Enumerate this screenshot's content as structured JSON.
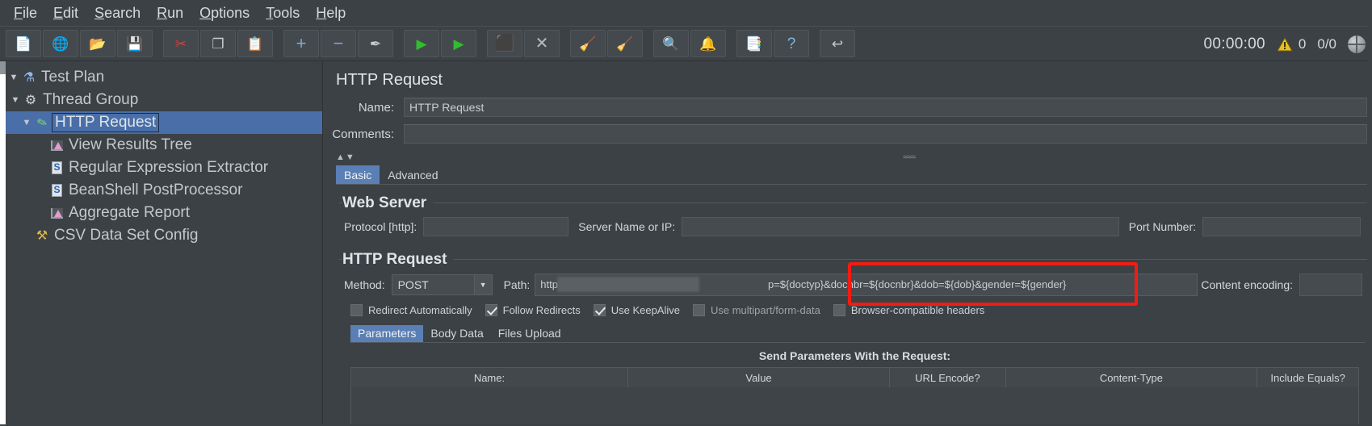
{
  "menubar": {
    "items": [
      {
        "label": "File",
        "mnemonic": "F"
      },
      {
        "label": "Edit",
        "mnemonic": "E"
      },
      {
        "label": "Search",
        "mnemonic": "S"
      },
      {
        "label": "Run",
        "mnemonic": "R"
      },
      {
        "label": "Options",
        "mnemonic": "O"
      },
      {
        "label": "Tools",
        "mnemonic": "T"
      },
      {
        "label": "Help",
        "mnemonic": "H"
      }
    ]
  },
  "toolbar": {
    "buttons": [
      {
        "name": "new-icon",
        "glyph": "📄",
        "title": "New"
      },
      {
        "name": "templates-icon",
        "glyph": "🌐",
        "title": "Templates"
      },
      {
        "name": "open-icon",
        "glyph": "📂",
        "title": "Open"
      },
      {
        "name": "save-icon",
        "glyph": "💾",
        "title": "Save"
      },
      {
        "name": "cut-icon",
        "glyph": "✂",
        "title": "Cut"
      },
      {
        "name": "copy-icon",
        "glyph": "❐",
        "title": "Copy"
      },
      {
        "name": "paste-icon",
        "glyph": "📋",
        "title": "Paste"
      },
      {
        "name": "expand-all-icon",
        "glyph": "+",
        "title": "Expand All"
      },
      {
        "name": "collapse-all-icon",
        "glyph": "−",
        "title": "Collapse All"
      },
      {
        "name": "toggle-icon",
        "glyph": "✒",
        "title": "Toggle"
      },
      {
        "name": "start-icon",
        "glyph": "▶",
        "title": "Start"
      },
      {
        "name": "start-no-pauses-icon",
        "glyph": "▶",
        "title": "Start no pauses"
      },
      {
        "name": "stop-icon",
        "glyph": "⬛",
        "title": "Stop"
      },
      {
        "name": "shutdown-icon",
        "glyph": "✕",
        "title": "Shutdown"
      },
      {
        "name": "clear-icon",
        "glyph": "🧹",
        "title": "Clear"
      },
      {
        "name": "clear-all-icon",
        "glyph": "🧹",
        "title": "Clear All"
      },
      {
        "name": "search-binoculars-icon",
        "glyph": "🔍",
        "title": "Search"
      },
      {
        "name": "reset-search-icon",
        "glyph": "🔔",
        "title": "Reset Search"
      },
      {
        "name": "function-helper-icon",
        "glyph": "📑",
        "title": "Function Helper"
      },
      {
        "name": "help-icon",
        "glyph": "?",
        "title": "Help"
      },
      {
        "name": "undo-redo-icon",
        "glyph": "↩",
        "title": "Undo"
      }
    ],
    "elapsed_time": "00:00:00",
    "warning_count": "0",
    "threads_ratio": "0/0"
  },
  "tree": {
    "nodes": [
      {
        "label": "Test Plan",
        "icon": "flask-icon",
        "indent": 0,
        "twisty": "▼",
        "selected": false
      },
      {
        "label": "Thread Group",
        "icon": "gear-icon",
        "indent": 1,
        "twisty": "▼",
        "selected": false
      },
      {
        "label": "HTTP Request",
        "icon": "pencil-icon",
        "indent": 2,
        "twisty": "▼",
        "selected": true
      },
      {
        "label": "View Results Tree",
        "icon": "chart-icon",
        "indent": 3,
        "twisty": "",
        "selected": false
      },
      {
        "label": "Regular Expression Extractor",
        "icon": "script-icon",
        "indent": 3,
        "twisty": "",
        "selected": false
      },
      {
        "label": "BeanShell PostProcessor",
        "icon": "script-icon",
        "indent": 3,
        "twisty": "",
        "selected": false
      },
      {
        "label": "Aggregate Report",
        "icon": "chart-icon",
        "indent": 3,
        "twisty": "",
        "selected": false
      },
      {
        "label": "CSV Data Set Config",
        "icon": "tools-icon",
        "indent": 2,
        "twisty": "",
        "selected": false
      }
    ]
  },
  "panel": {
    "title": "HTTP Request",
    "name_label": "Name:",
    "name_value": "HTTP Request",
    "comments_label": "Comments:",
    "comments_value": "",
    "tabs": [
      {
        "label": "Basic",
        "active": true
      },
      {
        "label": "Advanced",
        "active": false
      }
    ],
    "web_server": {
      "title": "Web Server",
      "protocol_label": "Protocol [http]:",
      "protocol_value": "",
      "server_label": "Server Name or IP:",
      "server_value": "",
      "port_label": "Port Number:",
      "port_value": ""
    },
    "http_request": {
      "title": "HTTP Request",
      "method_label": "Method:",
      "method_value": "POST",
      "path_label": "Path:",
      "path_value_prefix": "http",
      "path_value_suffix": "p=${doctyp}&docnbr=${docnbr}&dob=${dob}&gender=${gender}",
      "content_encoding_label": "Content encoding:",
      "content_encoding_value": "",
      "checkboxes": [
        {
          "label": "Redirect Automatically",
          "checked": false
        },
        {
          "label": "Follow Redirects",
          "checked": true
        },
        {
          "label": "Use KeepAlive",
          "checked": true
        },
        {
          "label": "Use multipart/form-data",
          "checked": false
        },
        {
          "label": "Browser-compatible headers",
          "checked": false
        }
      ],
      "subtabs": [
        {
          "label": "Parameters",
          "active": true
        },
        {
          "label": "Body Data",
          "active": false
        },
        {
          "label": "Files Upload",
          "active": false
        }
      ],
      "send_params_title": "Send Parameters With the Request:",
      "table_headers": [
        "Name:",
        "Value",
        "URL Encode?",
        "Content-Type",
        "Include Equals?"
      ],
      "table_rows": []
    }
  },
  "colors": {
    "window_bg": "#3c4145",
    "selection_blue": "#4a6fa8",
    "tab_active": "#5a7fb5",
    "highlight_red": "#f41b12",
    "warning_yellow": "#e8c020",
    "text": "#c8cdd1"
  }
}
